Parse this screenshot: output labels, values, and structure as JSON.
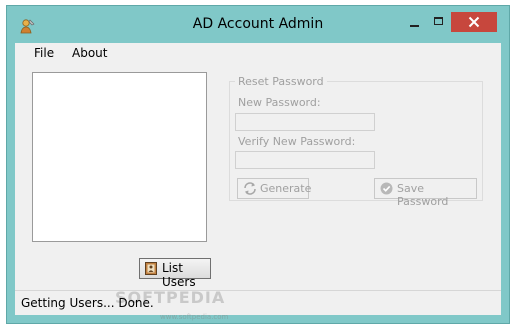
{
  "window": {
    "title": "AD Account Admin"
  },
  "colors": {
    "titlebar": "#80c8c8",
    "close_button": "#c7473d",
    "client": "#f0f0f0"
  },
  "menu": {
    "items": [
      "File",
      "About"
    ]
  },
  "users": {
    "list_button_label": "List Users",
    "items": []
  },
  "reset_password": {
    "group_title": "Reset Password",
    "new_password_label": "New Password:",
    "new_password_value": "",
    "verify_password_label": "Verify New Password:",
    "verify_password_value": "",
    "generate_button_label": "Generate",
    "save_button_label": "Save Password"
  },
  "status": {
    "text": "Getting Users... Done."
  },
  "watermark": {
    "main": "SOFTPEDIA",
    "sub": "www.softpedia.com"
  }
}
